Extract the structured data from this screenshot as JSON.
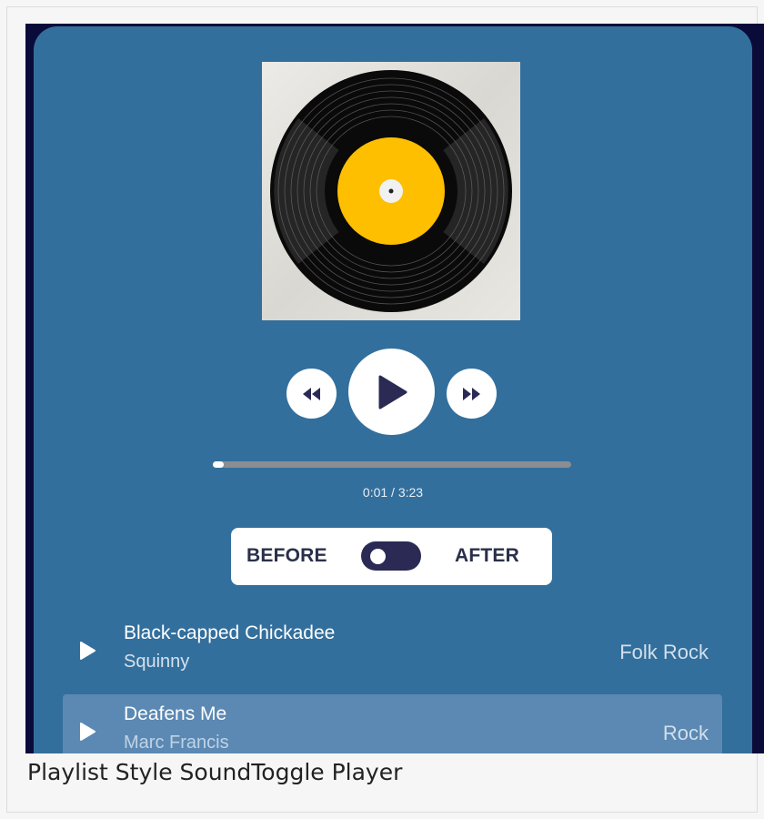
{
  "player": {
    "album_art": "vinyl-record",
    "colors": {
      "card_bg": "#336f9c",
      "label": "#fdbf00",
      "active_row": "#5b89b3",
      "button_icon": "#2a2a55"
    },
    "controls": {
      "rewind_icon": "rewind-icon",
      "play_icon": "play-icon",
      "forward_icon": "fast-forward-icon"
    },
    "progress": 0.02,
    "time": "0:01 / 3:23",
    "toggle": {
      "before_label": "BEFORE",
      "after_label": "AFTER",
      "state": "before"
    }
  },
  "playlist": [
    {
      "title": "Black-capped Chickadee",
      "artist": "Squinny",
      "genre": "Folk Rock",
      "active": false
    },
    {
      "title": "Deafens Me",
      "artist": "Marc Francis",
      "genre": "Rock",
      "active": true
    }
  ],
  "caption": "Playlist Style SoundToggle Player"
}
